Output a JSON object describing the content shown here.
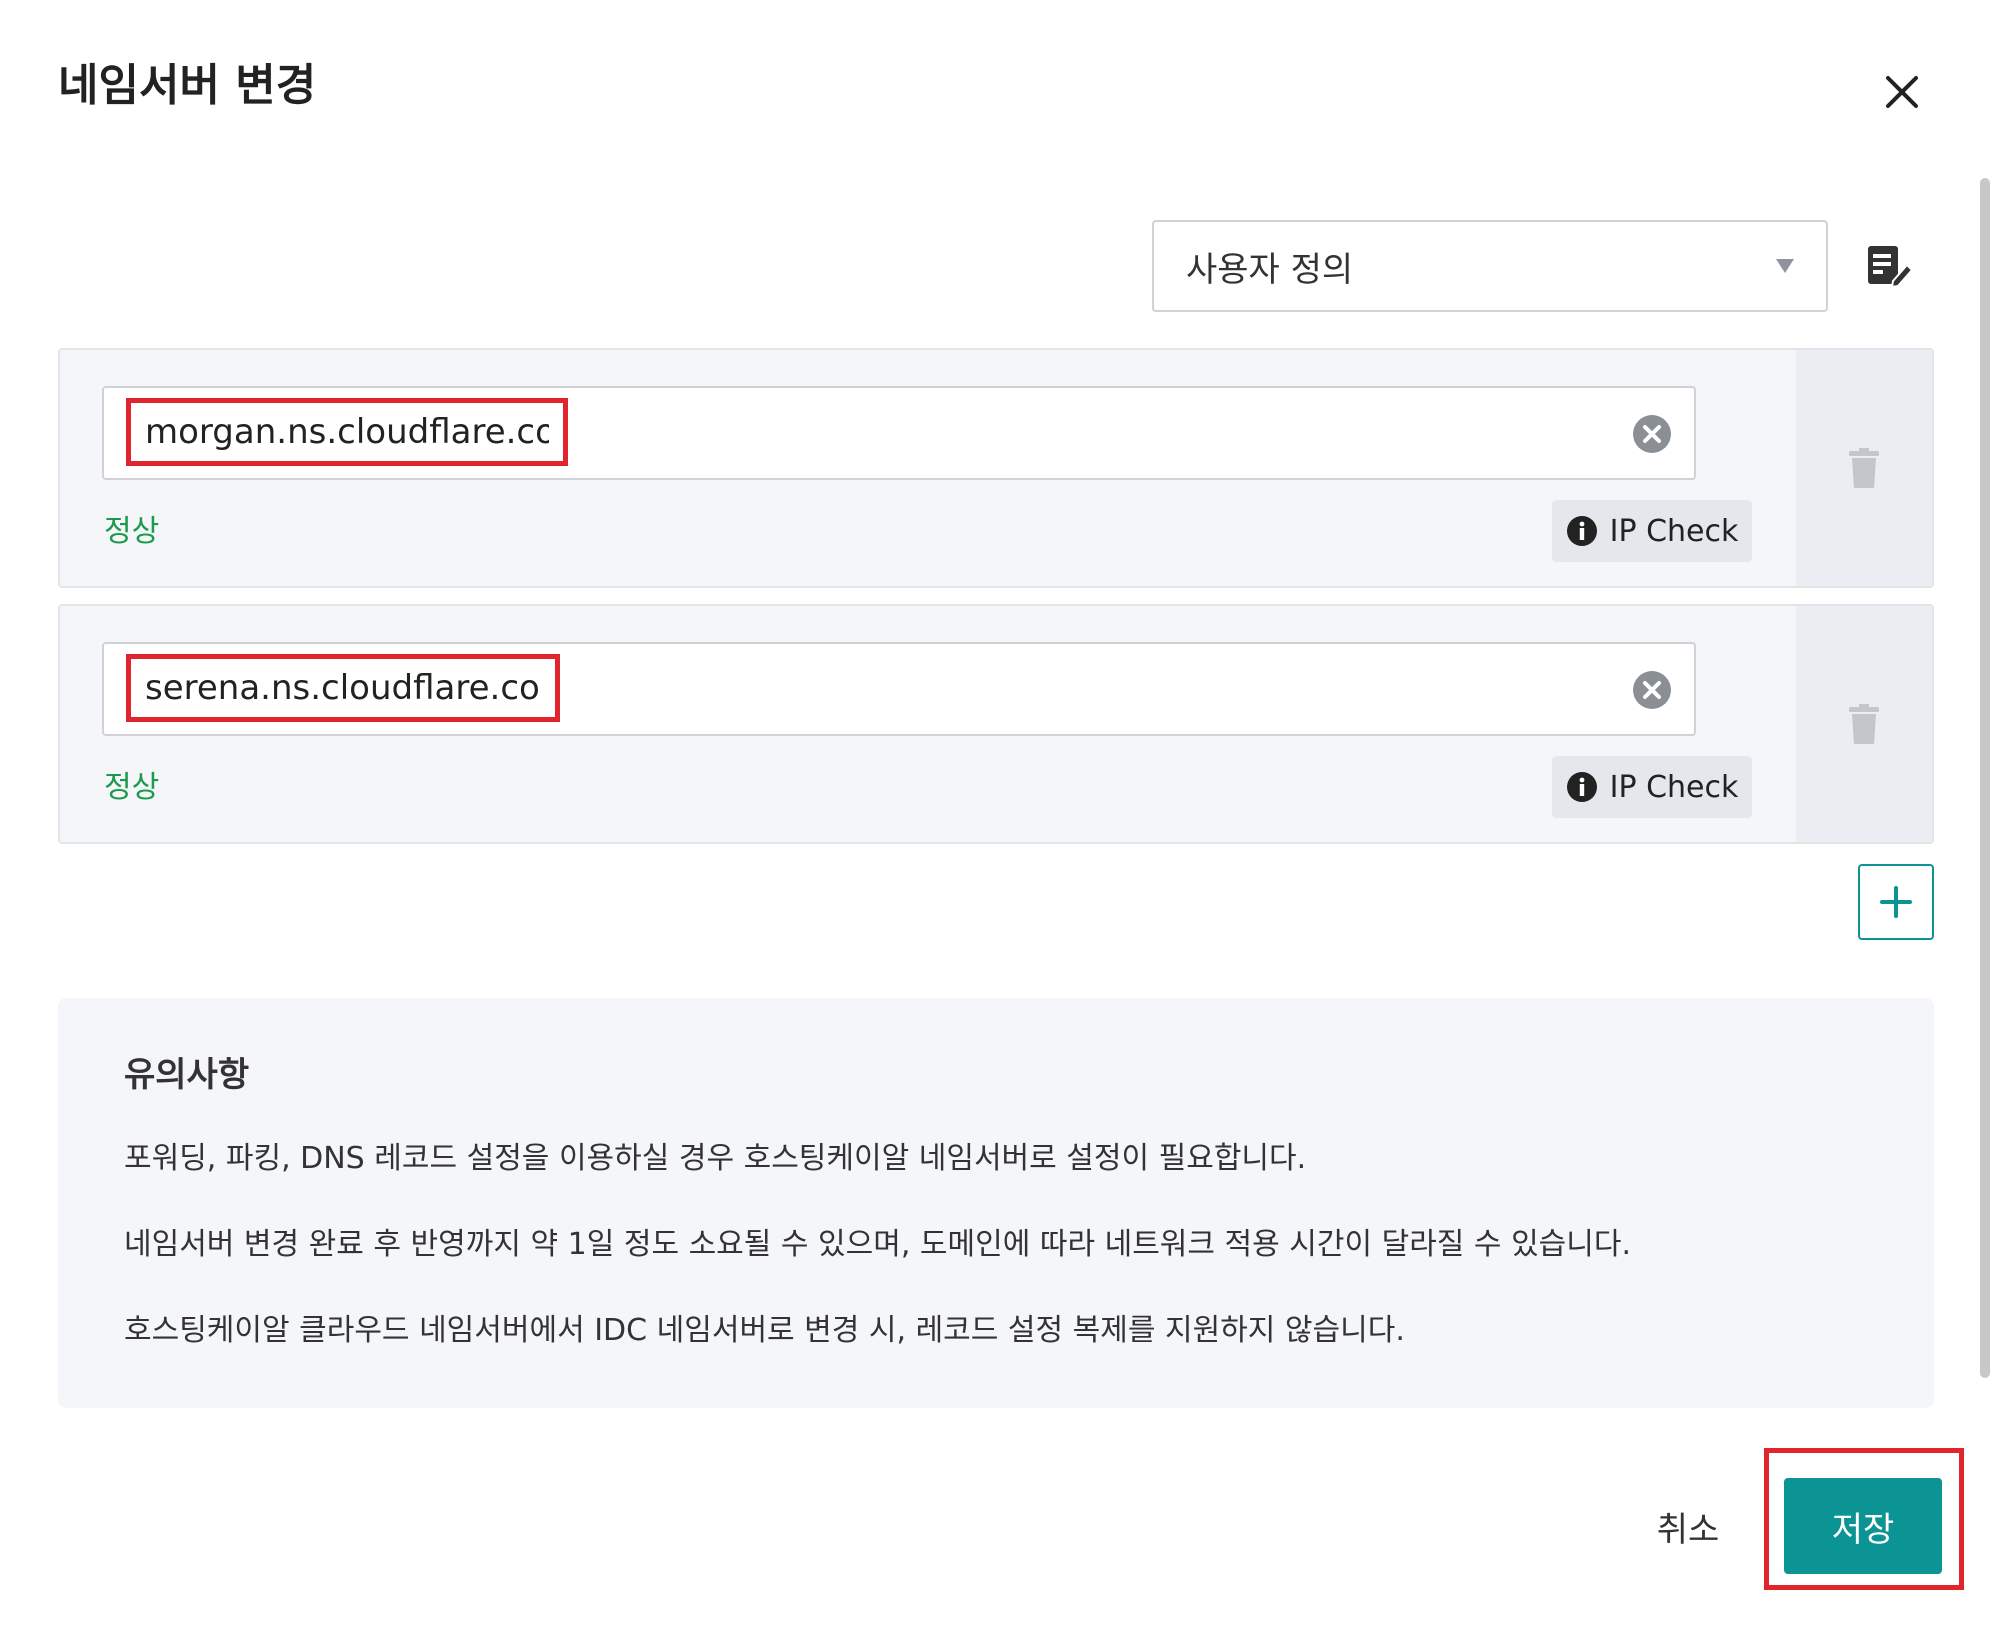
{
  "dialog": {
    "title": "네임서버 변경"
  },
  "preset": {
    "selected": "사용자 정의"
  },
  "nameservers": [
    {
      "value": "morgan.ns.cloudflare.com",
      "status": "정상",
      "ip_check_label": "IP Check"
    },
    {
      "value": "serena.ns.cloudflare.com",
      "status": "정상",
      "ip_check_label": "IP Check"
    }
  ],
  "notice": {
    "title": "유의사항",
    "lines": [
      "포워딩, 파킹, DNS 레코드 설정을 이용하실 경우 호스팅케이알 네임서버로 설정이 필요합니다.",
      "네임서버 변경 완료 후 반영까지 약 1일 정도 소요될 수 있으며, 도메인에 따라 네트워크 적용 시간이 달라질 수 있습니다.",
      "호스팅케이알 클라우드 네임서버에서 IDC 네임서버로 변경 시, 레코드 설정 복제를 지원하지 않습니다."
    ]
  },
  "footer": {
    "cancel_label": "취소",
    "save_label": "저장"
  },
  "colors": {
    "accent": "#0c9394",
    "status_ok": "#1b9a4c",
    "highlight": "#e0262c"
  },
  "icons": {
    "close": "close-icon",
    "edit": "edit-note-icon",
    "clear": "clear-circle-icon",
    "info": "info-circle-icon",
    "delete": "trash-icon",
    "add": "plus-icon",
    "dropdown": "dropdown-arrow-icon"
  }
}
